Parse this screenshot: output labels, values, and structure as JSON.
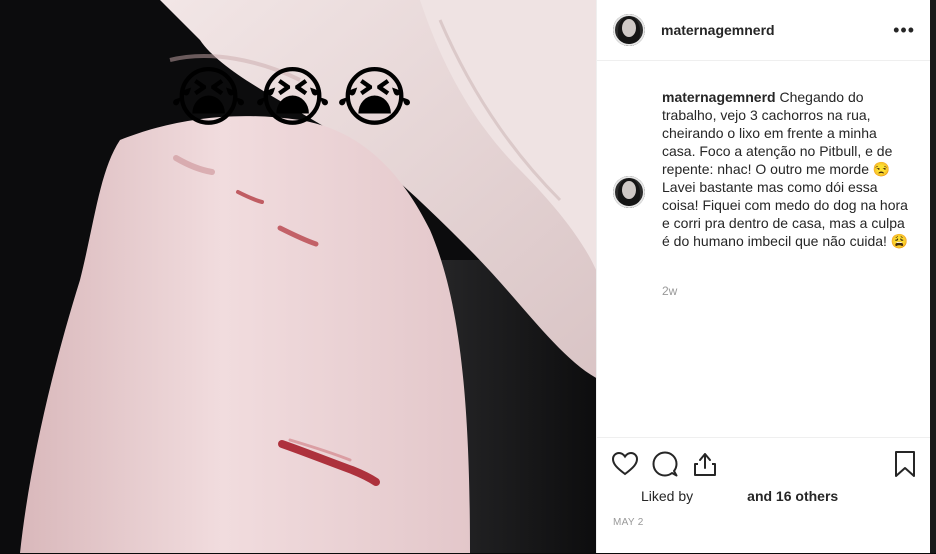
{
  "post": {
    "username": "maternagemnerd",
    "caption_username": "maternagemnerd",
    "caption_text": " Chegando do trabalho, vejo 3 cachorros na rua, cheirando o lixo em frente a minha casa. Foco a atenção no Pitbull, e de repente: nhac! O outro me morde 😒 Lavei bastante mas como dói essa coisa! Fiquei com medo do dog na hora e corri pra dentro de casa, mas a culpa é do humano imbecil que não cuida! 😩",
    "time_ago": "2w",
    "liked_by_label": "Liked by",
    "likes_rest": "and 16 others",
    "date": "MAY 2",
    "more_label": "•••"
  },
  "photo": {
    "emoji": [
      "😭",
      "😭",
      "😭"
    ]
  },
  "icons": {
    "like": "heart-icon",
    "comment": "comment-icon",
    "share": "share-icon",
    "save": "bookmark-icon"
  }
}
